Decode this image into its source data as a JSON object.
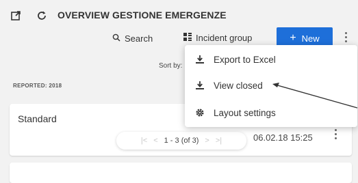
{
  "header": {
    "title": "OVERVIEW GESTIONE EMERGENZE",
    "open_icon": "open-external-icon",
    "refresh_icon": "refresh-icon"
  },
  "toolbar": {
    "search_label": "Search",
    "search_icon": "search-icon",
    "incident_group_label": "Incident group",
    "incident_group_icon": "group-icon",
    "new_label": "New",
    "new_icon": "plus-icon",
    "accent_color": "#1e6fd9"
  },
  "sort": {
    "label": "Sort by:"
  },
  "group_header": "REPORTED: 2018",
  "card": {
    "title": "Standard",
    "date": "06.02.18 15:25"
  },
  "pager": {
    "first": "|<",
    "prev": "<",
    "range": "1 - 3 (of 3)",
    "next": ">",
    "last": ">|"
  },
  "menu": {
    "items": [
      {
        "label": "Export to Excel",
        "icon": "download-icon"
      },
      {
        "label": "View closed",
        "icon": "download-icon"
      },
      {
        "label": "Layout settings",
        "icon": "gear-icon"
      }
    ]
  }
}
